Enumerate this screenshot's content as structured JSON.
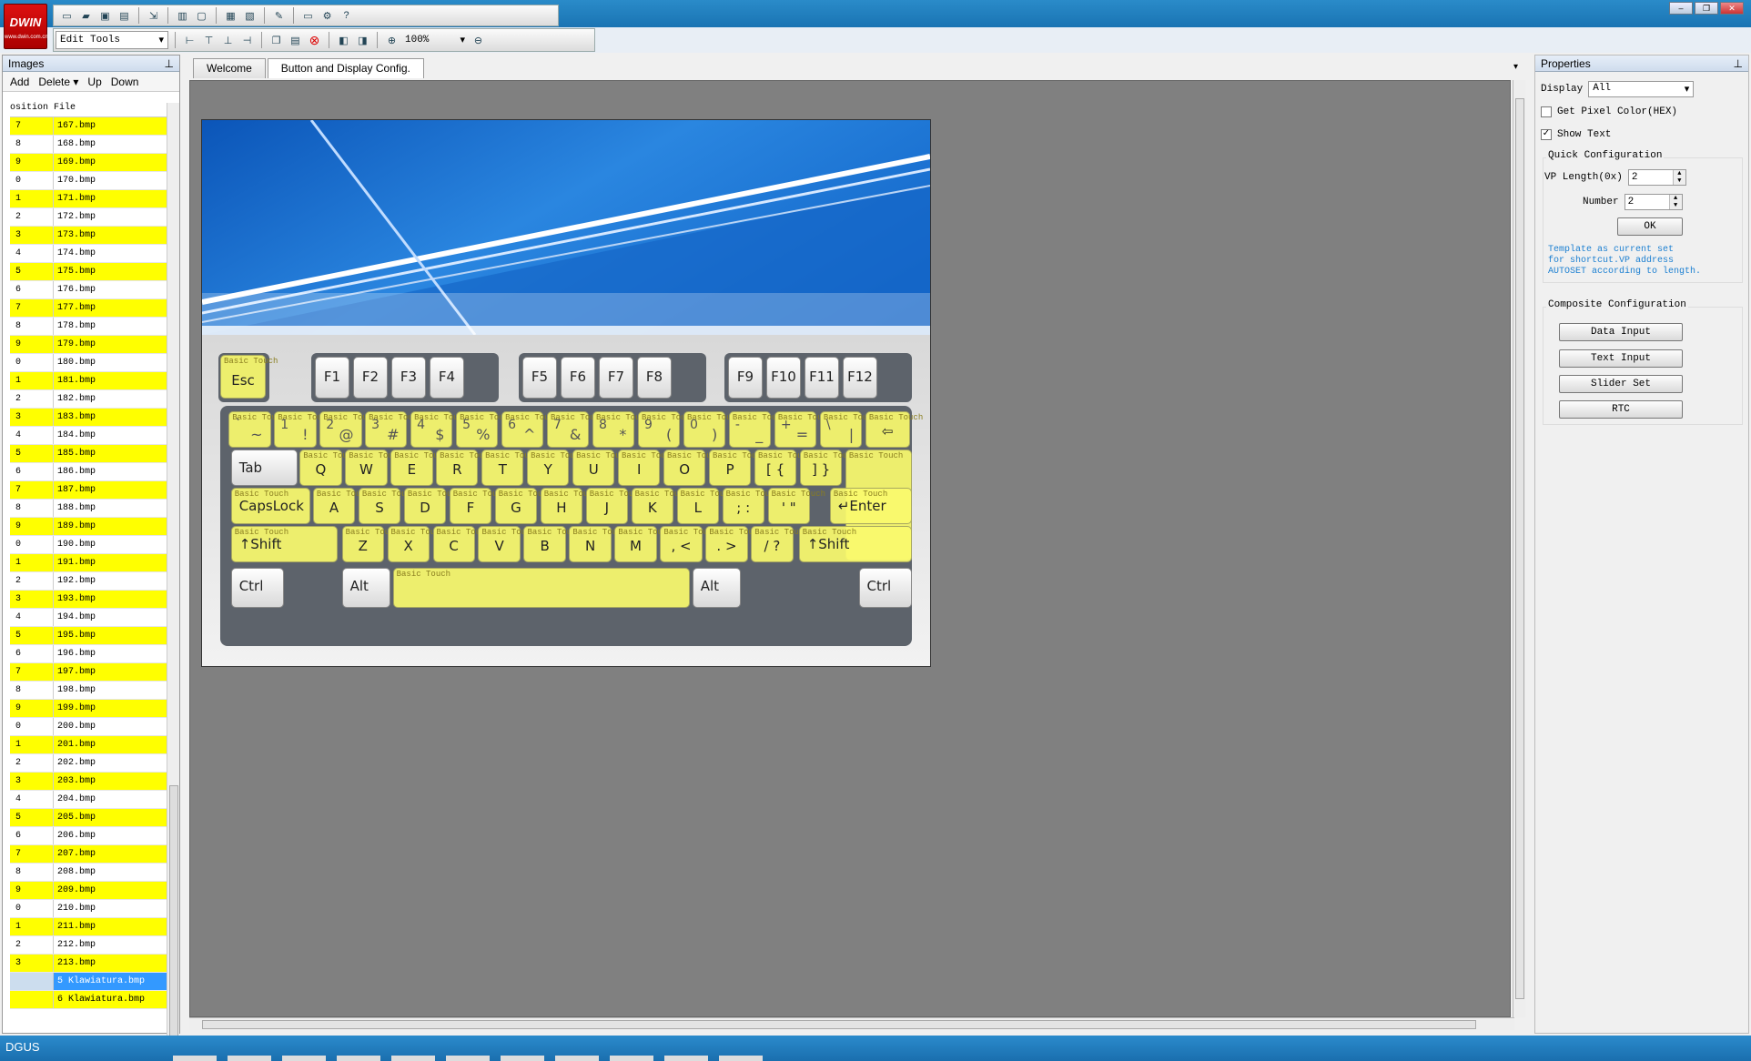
{
  "logo": {
    "brand": "DWIN",
    "tag": "www.dwin.com.cn"
  },
  "toolbar": {
    "edit_tools": "Edit Tools",
    "zoom": "100%"
  },
  "images_panel": {
    "title": "Images",
    "actions": {
      "add": "Add",
      "delete": "Delete",
      "up": "Up",
      "down": "Down"
    },
    "columns": {
      "position": "osition",
      "file": "File"
    },
    "rows": [
      {
        "pos": "7",
        "file": "167.bmp",
        "hl": true
      },
      {
        "pos": "8",
        "file": "168.bmp",
        "hl": false
      },
      {
        "pos": "9",
        "file": "169.bmp",
        "hl": true
      },
      {
        "pos": "0",
        "file": "170.bmp",
        "hl": false
      },
      {
        "pos": "1",
        "file": "171.bmp",
        "hl": true
      },
      {
        "pos": "2",
        "file": "172.bmp",
        "hl": false
      },
      {
        "pos": "3",
        "file": "173.bmp",
        "hl": true
      },
      {
        "pos": "4",
        "file": "174.bmp",
        "hl": false
      },
      {
        "pos": "5",
        "file": "175.bmp",
        "hl": true
      },
      {
        "pos": "6",
        "file": "176.bmp",
        "hl": false
      },
      {
        "pos": "7",
        "file": "177.bmp",
        "hl": true
      },
      {
        "pos": "8",
        "file": "178.bmp",
        "hl": false
      },
      {
        "pos": "9",
        "file": "179.bmp",
        "hl": true
      },
      {
        "pos": "0",
        "file": "180.bmp",
        "hl": false
      },
      {
        "pos": "1",
        "file": "181.bmp",
        "hl": true
      },
      {
        "pos": "2",
        "file": "182.bmp",
        "hl": false
      },
      {
        "pos": "3",
        "file": "183.bmp",
        "hl": true
      },
      {
        "pos": "4",
        "file": "184.bmp",
        "hl": false
      },
      {
        "pos": "5",
        "file": "185.bmp",
        "hl": true
      },
      {
        "pos": "6",
        "file": "186.bmp",
        "hl": false
      },
      {
        "pos": "7",
        "file": "187.bmp",
        "hl": true
      },
      {
        "pos": "8",
        "file": "188.bmp",
        "hl": false
      },
      {
        "pos": "9",
        "file": "189.bmp",
        "hl": true
      },
      {
        "pos": "0",
        "file": "190.bmp",
        "hl": false
      },
      {
        "pos": "1",
        "file": "191.bmp",
        "hl": true
      },
      {
        "pos": "2",
        "file": "192.bmp",
        "hl": false
      },
      {
        "pos": "3",
        "file": "193.bmp",
        "hl": true
      },
      {
        "pos": "4",
        "file": "194.bmp",
        "hl": false
      },
      {
        "pos": "5",
        "file": "195.bmp",
        "hl": true
      },
      {
        "pos": "6",
        "file": "196.bmp",
        "hl": false
      },
      {
        "pos": "7",
        "file": "197.bmp",
        "hl": true
      },
      {
        "pos": "8",
        "file": "198.bmp",
        "hl": false
      },
      {
        "pos": "9",
        "file": "199.bmp",
        "hl": true
      },
      {
        "pos": "0",
        "file": "200.bmp",
        "hl": false
      },
      {
        "pos": "1",
        "file": "201.bmp",
        "hl": true
      },
      {
        "pos": "2",
        "file": "202.bmp",
        "hl": false
      },
      {
        "pos": "3",
        "file": "203.bmp",
        "hl": true
      },
      {
        "pos": "4",
        "file": "204.bmp",
        "hl": false
      },
      {
        "pos": "5",
        "file": "205.bmp",
        "hl": true
      },
      {
        "pos": "6",
        "file": "206.bmp",
        "hl": false
      },
      {
        "pos": "7",
        "file": "207.bmp",
        "hl": true
      },
      {
        "pos": "8",
        "file": "208.bmp",
        "hl": false
      },
      {
        "pos": "9",
        "file": "209.bmp",
        "hl": true
      },
      {
        "pos": "0",
        "file": "210.bmp",
        "hl": false
      },
      {
        "pos": "1",
        "file": "211.bmp",
        "hl": true
      },
      {
        "pos": "2",
        "file": "212.bmp",
        "hl": false
      },
      {
        "pos": "3",
        "file": "213.bmp",
        "hl": true
      },
      {
        "pos": "",
        "file": "5 Klawiatura.bmp",
        "hl": false,
        "selected": true
      },
      {
        "pos": "",
        "file": "6 Klawiatura.bmp",
        "hl": true
      }
    ]
  },
  "tabs": [
    {
      "label": "Welcome",
      "active": false
    },
    {
      "label": "Button and Display Config.",
      "active": true
    }
  ],
  "keyboard": {
    "touch_label": "Basic Touch",
    "esc": "Esc",
    "fkeys": [
      "F1",
      "F2",
      "F3",
      "F4",
      "F5",
      "F6",
      "F7",
      "F8",
      "F9",
      "F10",
      "F11",
      "F12"
    ],
    "row1": [
      [
        "`",
        "~"
      ],
      [
        "1",
        "!"
      ],
      [
        "2",
        "@"
      ],
      [
        "3",
        "#"
      ],
      [
        "4",
        "$"
      ],
      [
        "5",
        "%"
      ],
      [
        "6",
        "^"
      ],
      [
        "7",
        "&"
      ],
      [
        "8",
        "*"
      ],
      [
        "9",
        "("
      ],
      [
        "0",
        ")"
      ],
      [
        "-",
        "_"
      ],
      [
        "+",
        "="
      ],
      [
        "\\",
        "|"
      ]
    ],
    "backspace": "⇦",
    "tab": "Tab",
    "row2": [
      "Q",
      "W",
      "E",
      "R",
      "T",
      "Y",
      "U",
      "I",
      "O",
      "P",
      "[ {",
      "] }"
    ],
    "capslock": "CapsLock",
    "row3": [
      "A",
      "S",
      "D",
      "F",
      "G",
      "H",
      "J",
      "K",
      "L",
      "; :",
      "' \""
    ],
    "enter": "↵Enter",
    "shift": "↑Shift",
    "row4": [
      "Z",
      "X",
      "C",
      "V",
      "B",
      "N",
      "M",
      ", <",
      ". >",
      "/ ?"
    ],
    "ctrl": "Ctrl",
    "alt": "Alt"
  },
  "properties": {
    "title": "Properties",
    "display_label": "Display",
    "display_value": "All",
    "get_pixel_label": "Get Pixel Color(HEX)",
    "get_pixel_checked": false,
    "show_text_label": "Show Text",
    "show_text_checked": true,
    "quick_config_title": "Quick Configuration",
    "vp_length_label": "VP Length(0x)",
    "vp_length_value": "2",
    "number_label": "Number",
    "number_value": "2",
    "ok": "OK",
    "note_lines": [
      "Template as current set",
      "for shortcut.VP address",
      "AUTOSET according to length."
    ],
    "composite_title": "Composite Configuration",
    "buttons": {
      "data_input": "Data Input",
      "text_input": "Text Input",
      "slider_set": "Slider Set",
      "rtc": "RTC"
    }
  },
  "status": {
    "text": "DGUS"
  },
  "colors": {
    "highlight": "#ffff00",
    "selection": "#3399ff",
    "accent": "#1a74b3",
    "touch_overlay": "#fafa6e"
  }
}
